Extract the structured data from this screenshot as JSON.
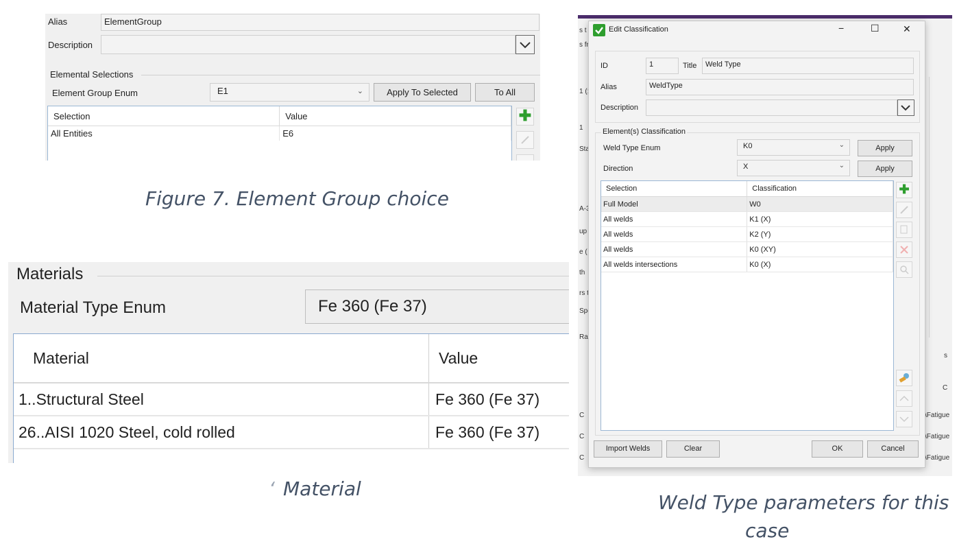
{
  "panel1": {
    "alias_label": "Alias",
    "alias_value": "ElementGroup",
    "description_label": "Description",
    "section_label": "Elemental Selections",
    "enum_label": "Element Group Enum",
    "enum_value": "E1",
    "apply_selected_label": "Apply To Selected",
    "to_all_label": "To All",
    "columns": [
      "Selection",
      "Value"
    ],
    "rows": [
      {
        "selection": "All Entities",
        "value": "E6"
      }
    ]
  },
  "caption1": "Figure 7. Element Group choice",
  "panel2": {
    "section_label": "Materials",
    "enum_label": "Material Type Enum",
    "enum_value": "Fe 360 (Fe 37)",
    "columns": [
      "Material",
      "Value"
    ],
    "rows": [
      {
        "material": "1..Structural Steel",
        "value": "Fe 360 (Fe 37)"
      },
      {
        "material": "26..AISI 1020 Steel, cold rolled",
        "value": "Fe 360 (Fe 37)"
      }
    ]
  },
  "caption2": "Material",
  "dialog": {
    "title": "Edit Classification",
    "minimize": "−",
    "maximize": "☐",
    "close": "✕",
    "id_label": "ID",
    "id_value": "1",
    "title_label": "Title",
    "title_value": "Weld Type",
    "alias_label": "Alias",
    "alias_value": "WeldType",
    "description_label": "Description",
    "section_label": "Element(s) Classification",
    "weld_enum_label": "Weld Type Enum",
    "weld_enum_value": "K0",
    "direction_label": "Direction",
    "direction_value": "X",
    "apply_label": "Apply",
    "columns": [
      "Selection",
      "Classification"
    ],
    "rows": [
      {
        "selection": "Full Model",
        "classification": "W0"
      },
      {
        "selection": "All welds",
        "classification": "K1 (X)"
      },
      {
        "selection": "All welds",
        "classification": "K2 (Y)"
      },
      {
        "selection": "All welds",
        "classification": "K0 (XY)"
      },
      {
        "selection": "All welds intersections",
        "classification": "K0 (X)"
      }
    ],
    "import_label": "Import Welds",
    "clear_label": "Clear",
    "ok_label": "OK",
    "cancel_label": "Cancel"
  },
  "background_fragments": {
    "left": [
      "s t",
      "s fr",
      "1 (:",
      "1",
      "Sta",
      "A-3",
      "up",
      "e (",
      "th ",
      "rs t",
      "Spe",
      "Rain",
      "C",
      "C",
      "C"
    ],
    "right": [
      "s",
      "C",
      "\\Fatigue",
      "\\Fatigue",
      "\\Fatigue"
    ]
  },
  "caption3_line1": "Weld Type parameters for this",
  "caption3_line2": "case",
  "colors": {
    "accent_green": "#2e9e2e",
    "grid_border": "#9bb7d4",
    "caption": "#445266",
    "titlebar_purple": "#4b2c6b"
  }
}
